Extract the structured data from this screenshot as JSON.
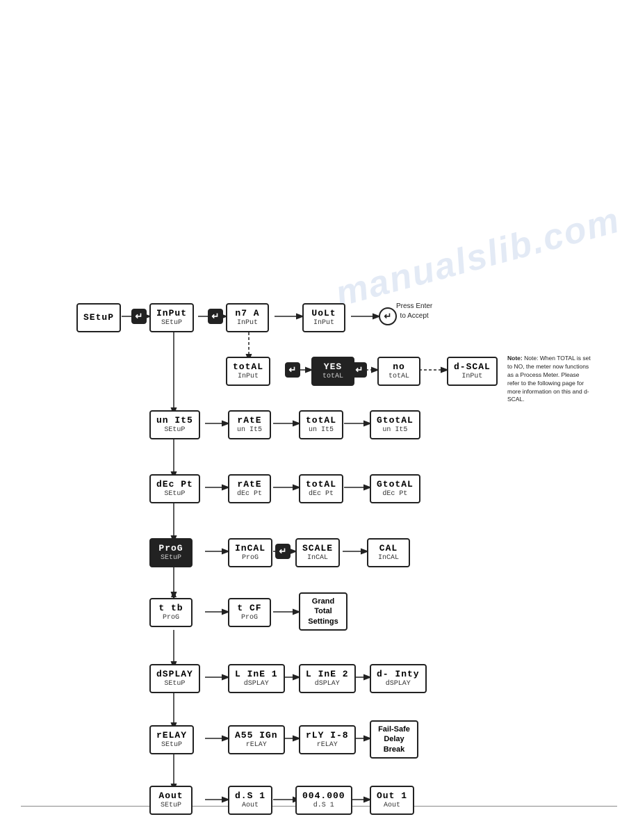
{
  "watermark": "manualslib.com",
  "nodes": {
    "setup": {
      "top": "SEtuP",
      "bot": ""
    },
    "input_setup": {
      "top": "InPut",
      "bot": "SEtuP"
    },
    "n7a_input": {
      "top": "n7 A",
      "bot": "InPut"
    },
    "volt_input": {
      "top": "UoLt",
      "bot": "InPut"
    },
    "total_input": {
      "top": "totAL",
      "bot": "InPut"
    },
    "yes_total": {
      "top": "YES",
      "bot": "totAL"
    },
    "no_total": {
      "top": "no",
      "bot": "totAL"
    },
    "dscal_input": {
      "top": "d-SCAL",
      "bot": "InPut"
    },
    "units_setup": {
      "top": "un It5",
      "bot": "SEtuP"
    },
    "rate_units": {
      "top": "rAtE",
      "bot": "un It5"
    },
    "total_units": {
      "top": "totAL",
      "bot": "un It5"
    },
    "gtotal_units": {
      "top": "GtotAL",
      "bot": "un It5"
    },
    "decpt_setup": {
      "top": "dEc Pt",
      "bot": "SEtuP"
    },
    "rate_decpt": {
      "top": "rAtE",
      "bot": "dEc Pt"
    },
    "total_decpt": {
      "top": "totAL",
      "bot": "dEc Pt"
    },
    "gtotal_decpt": {
      "top": "GtotAL",
      "bot": "dEc Pt"
    },
    "prog_setup": {
      "top": "ProG",
      "bot": "SEtuP"
    },
    "incal_prog": {
      "top": "InCAL",
      "bot": "ProG"
    },
    "scale_incal": {
      "top": "SCALE",
      "bot": "InCAL"
    },
    "cal_incal": {
      "top": "CAL",
      "bot": "InCAL"
    },
    "ttb_prog": {
      "top": "t tb",
      "bot": "ProG"
    },
    "tcf_prog": {
      "top": "t CF",
      "bot": "ProG"
    },
    "grand_total": {
      "top": "Grand\nTotal\nSettings",
      "bot": ""
    },
    "dsplay_setup": {
      "top": "dSPLAY",
      "bot": "SEtuP"
    },
    "line1_dsplay": {
      "top": "L InE 1",
      "bot": "dSPLAY"
    },
    "line2_dsplay": {
      "top": "L InE 2",
      "bot": "dSPLAY"
    },
    "dinty_dsplay": {
      "top": "d- Inty",
      "bot": "dSPLAY"
    },
    "relay_setup": {
      "top": "rELAY",
      "bot": "SEtuP"
    },
    "assign_relay": {
      "top": "A55 IGn",
      "bot": "rELAY"
    },
    "rly18_relay": {
      "top": "rLY I-8",
      "bot": "rELAY"
    },
    "failsafe": {
      "top": "Fail-Safe\nDelay\nBreak",
      "bot": ""
    },
    "aout_setup": {
      "top": "Aout",
      "bot": "SEtuP"
    },
    "ds1_aout": {
      "top": "d.S 1",
      "bot": "Aout"
    },
    "004000_ds1": {
      "top": "004.000",
      "bot": "d.S 1"
    },
    "out1_aout": {
      "top": "Out 1",
      "bot": "Aout"
    }
  },
  "labels": {
    "press_enter": "Press Enter\nto Accept"
  },
  "note": "Note: When TOTAL is set to NO, the meter now functions as a Process Meter. Please refer to the following page for more information on this and d-SCAL."
}
